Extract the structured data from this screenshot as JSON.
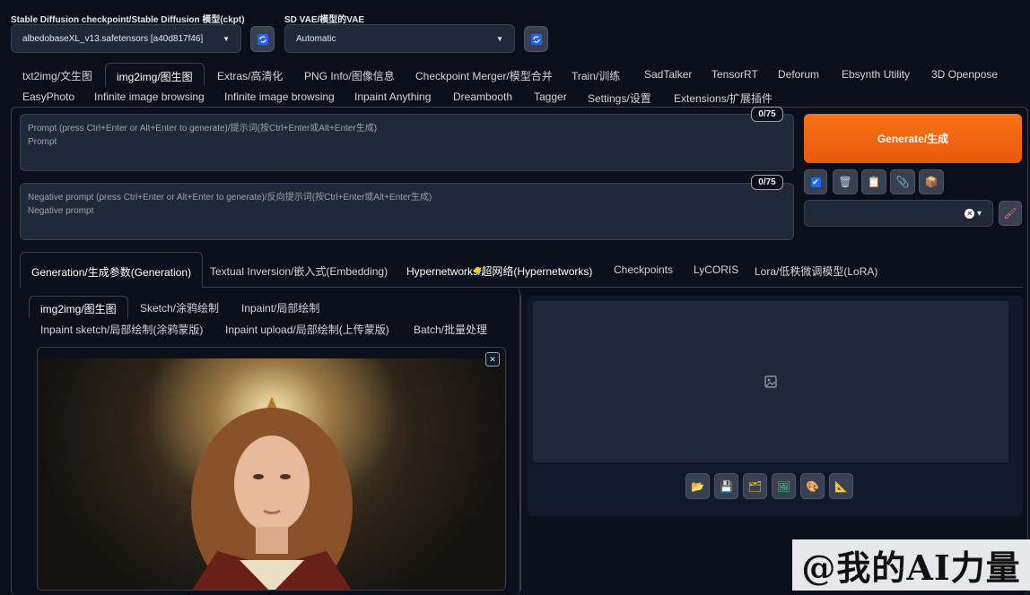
{
  "header": {
    "checkpoint_label": "Stable Diffusion checkpoint/Stable Diffusion 模型(ckpt)",
    "checkpoint_value": "albedobaseXL_v13.safetensors [a40d817f46]",
    "vae_label": "SD VAE/模型的VAE",
    "vae_value": "Automatic"
  },
  "main_tabs_row1": [
    "txt2img/文生图",
    "img2img/图生图",
    "Extras/高清化",
    "PNG Info/图像信息",
    "Checkpoint Merger/模型合并",
    "Train/训练",
    "SadTalker",
    "TensorRT",
    "Deforum",
    "Ebsynth Utility",
    "3D Openpose"
  ],
  "main_tabs_row2": [
    "EasyPhoto",
    "Infinite image browsing",
    "Infinite image browsing",
    "Inpaint Anything",
    "Dreambooth",
    "Tagger",
    "Settings/设置",
    "Extensions/扩展插件"
  ],
  "prompt": {
    "placeholder_line1": "Prompt (press Ctrl+Enter or Alt+Enter to generate)/提示词(按Ctrl+Enter或Alt+Enter生成)",
    "placeholder_line2": "Prompt",
    "counter": "0/75"
  },
  "negative_prompt": {
    "placeholder_line1": "Negative prompt (press Ctrl+Enter or Alt+Enter to generate)/反向提示词(按Ctrl+Enter或Alt+Enter生成)",
    "placeholder_line2": "Negative prompt",
    "counter": "0/75"
  },
  "generate_label": "Generate/生成",
  "param_tabs": [
    "Generation/生成参数(Generation)",
    "Textual Inversion/嵌入式(Embedding)",
    "Hypernetworks/超网络(Hypernetworks)",
    "Checkpoints",
    "LyCORIS",
    "Lora/低秩微调模型(LoRA)"
  ],
  "img2img_tabs_row1": [
    "img2img/图生图",
    "Sketch/涂鸦绘制",
    "Inpaint/局部绘制"
  ],
  "img2img_tabs_row2": [
    "Inpaint sketch/局部绘制(涂鸦蒙版)",
    "Inpaint upload/局部绘制(上传蒙版)",
    "Batch/批量处理"
  ],
  "watermark": "@我的AI力量",
  "colors": {
    "accent": "#f97316",
    "background": "#0b0f19",
    "panel": "#1f2937"
  }
}
